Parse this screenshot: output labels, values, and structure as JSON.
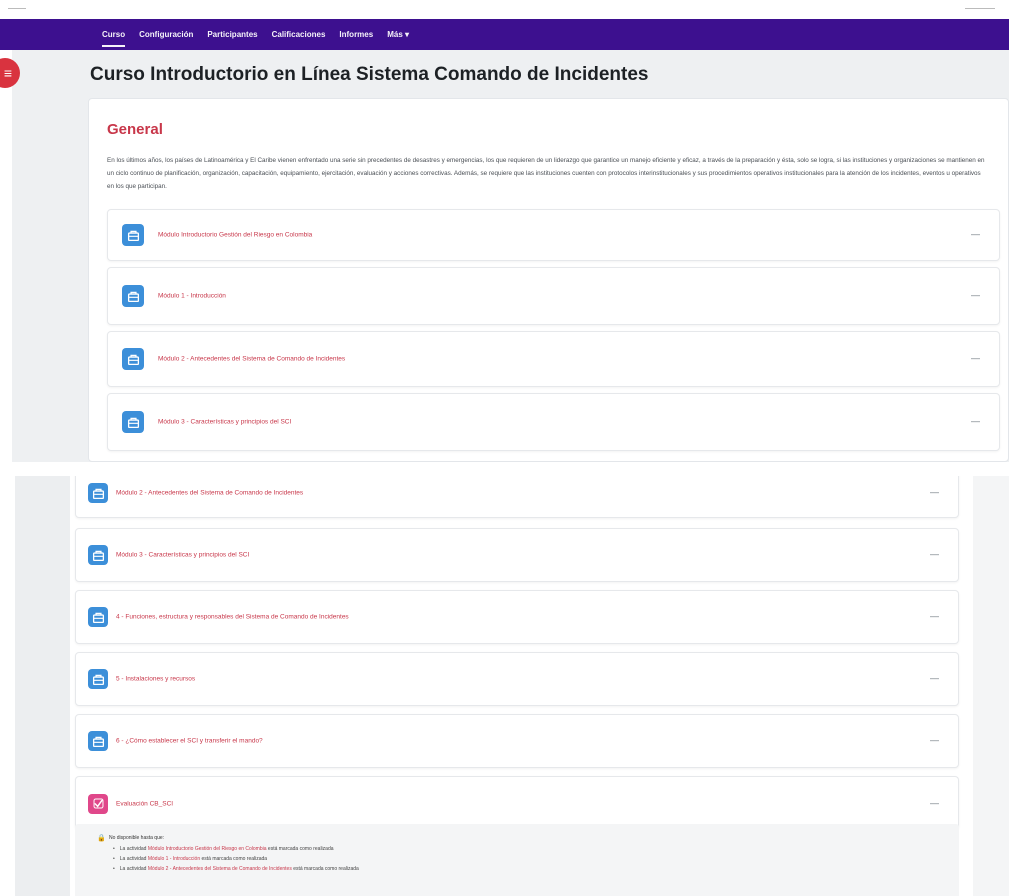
{
  "nav": {
    "items": [
      {
        "label": "Curso",
        "active": true
      },
      {
        "label": "Configuración",
        "active": false
      },
      {
        "label": "Participantes",
        "active": false
      },
      {
        "label": "Calificaciones",
        "active": false
      },
      {
        "label": "Informes",
        "active": false
      },
      {
        "label": "Más",
        "active": false,
        "dropdown": true
      }
    ],
    "background": "#3d108f"
  },
  "drawer_icon": "drawer-toggle-icon",
  "course": {
    "title": "Curso Introductorio en Línea Sistema Comando de Incidentes"
  },
  "section": {
    "title": "General",
    "summary": "En los últimos años, los países de Latinoamérica y El Caribe vienen enfrentado una serie sin precedentes de desastres y emergencias, los que requieren de un liderazgo que garantice un manejo eficiente y eficaz, a través de la preparación y ésta, solo se logra, si las instituciones y organizaciones se mantienen en un ciclo continuo de planificación, organización, capacitación, equipamiento, ejercitación, evaluación y acciones correctivas. Además, se requiere que las instituciones cuenten con protocolos interinstitucionales y sus procedimientos operativos institucionales para la atención de los incidentes, eventos u operativos en los que participan."
  },
  "activities_top": [
    {
      "label": "Módulo Introductorio Gestión del Riesgo en Colombia",
      "icon": "module-icon"
    },
    {
      "label": "Módulo 1 - Introducción",
      "icon": "module-icon"
    },
    {
      "label": "Módulo 2 - Antecedentes del Sistema de Comando de Incidentes",
      "icon": "module-icon"
    },
    {
      "label": "Módulo 3 - Características y principios del SCI",
      "icon": "module-icon"
    }
  ],
  "activities_bottom": [
    {
      "label": "Módulo 2 - Antecedentes del Sistema de Comando de Incidentes",
      "icon": "module-icon"
    },
    {
      "label": "Módulo 3 - Características y principios del SCI",
      "icon": "module-icon"
    },
    {
      "label": "4 - Funciones, estructura y responsables del Sistema de Comando de Incidentes",
      "icon": "module-icon"
    },
    {
      "label": "5 - Instalaciones y recursos",
      "icon": "module-icon"
    },
    {
      "label": "6 - ¿Cómo establecer el SCI y transferir el mando?",
      "icon": "module-icon"
    },
    {
      "label": "Evaluación CB_SCI",
      "icon": "quiz-icon"
    }
  ],
  "more_label": "—",
  "restriction": {
    "heading": "No disponible hasta que:",
    "items": [
      {
        "prefix": "La actividad ",
        "activity": "Módulo Introductorio Gestión del Riesgo en Colombia",
        "suffix": " está marcada como realizada"
      },
      {
        "prefix": "La actividad ",
        "activity": "Módulo 1 - Introducción",
        "suffix": " está marcada como realizada"
      },
      {
        "prefix": "La actividad ",
        "activity": "Módulo 2 - Antecedentes del Sistema de Comando de Incidentes",
        "suffix": " está marcada como realizada"
      }
    ]
  }
}
